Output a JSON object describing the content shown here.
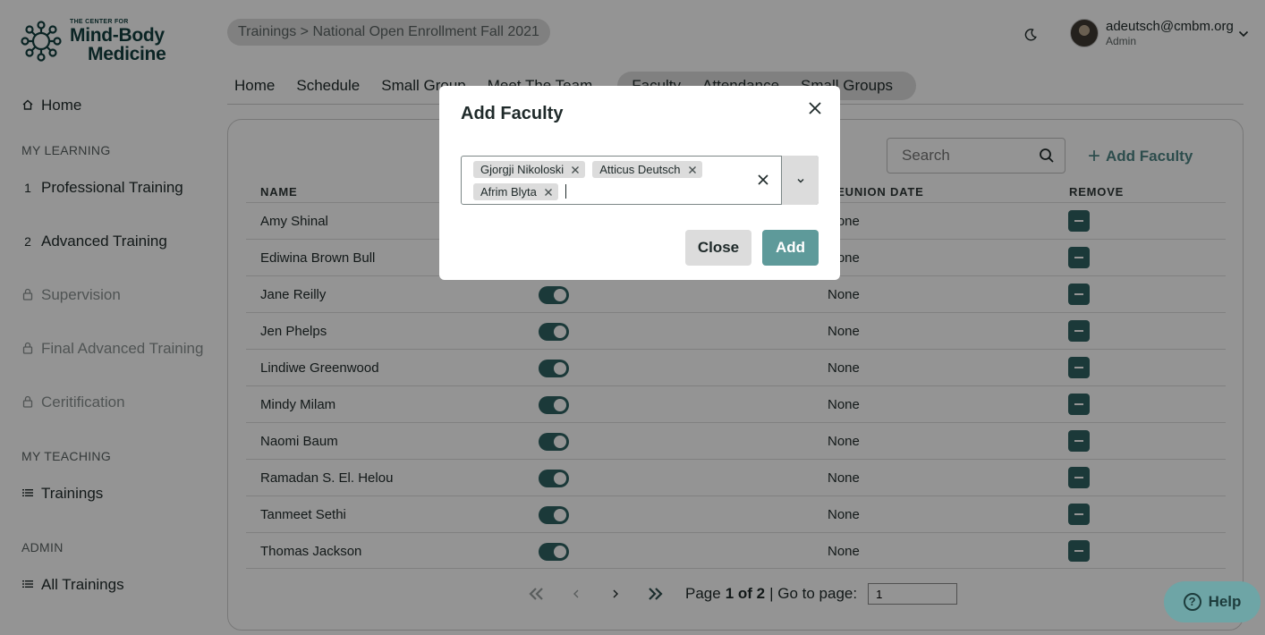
{
  "brand": {
    "small": "THE CENTER FOR",
    "line1": "Mind-Body",
    "line2": "Medicine"
  },
  "sidebar": {
    "home": "Home",
    "sections": {
      "learning": "MY LEARNING",
      "teaching": "MY TEACHING",
      "admin": "ADMIN"
    },
    "learning": [
      {
        "num": "1",
        "label": "Professional Training"
      },
      {
        "num": "2",
        "label": "Advanced Training"
      },
      {
        "label": "Supervision",
        "locked": true
      },
      {
        "label": "Final Advanced Training",
        "locked": true
      },
      {
        "label": "Ceritification",
        "locked": true
      }
    ],
    "teaching": [
      {
        "label": "Trainings"
      }
    ],
    "admin": [
      {
        "label": "All Trainings"
      }
    ]
  },
  "header": {
    "breadcrumb": "Trainings > National Open Enrollment Fall 2021",
    "user_email": "adeutsch@cmbm.org",
    "user_role": "Admin"
  },
  "tabs": {
    "plain": [
      "Home",
      "Schedule",
      "Small Group",
      "Meet The Team"
    ],
    "grouped": [
      "Faculty",
      "Attendance",
      "Small Groups"
    ]
  },
  "table": {
    "search_placeholder": "Search",
    "add_faculty_label": "Add Faculty",
    "headers": {
      "name": "NAME",
      "reunion": "REUNION DATE",
      "remove": "REMOVE"
    },
    "rows": [
      {
        "name": "Amy Shinal",
        "reunion": "None"
      },
      {
        "name": "Ediwina Brown Bull",
        "reunion": "None"
      },
      {
        "name": "Jane Reilly",
        "reunion": "None"
      },
      {
        "name": "Jen Phelps",
        "reunion": "None"
      },
      {
        "name": "Lindiwe Greenwood",
        "reunion": "None"
      },
      {
        "name": "Mindy Milam",
        "reunion": "None"
      },
      {
        "name": "Naomi Baum",
        "reunion": "None"
      },
      {
        "name": "Ramadan S. El. Helou",
        "reunion": "None"
      },
      {
        "name": "Tanmeet Sethi",
        "reunion": "None"
      },
      {
        "name": "Thomas Jackson",
        "reunion": "None"
      }
    ]
  },
  "pagination": {
    "page_word": "Page",
    "page_of": "1 of 2",
    "goto_label": "| Go to page:",
    "goto_value": "1"
  },
  "help": {
    "label": "Help"
  },
  "modal": {
    "title": "Add Faculty",
    "selected": [
      "Gjorgji Nikoloski",
      "Atticus Deutsch",
      "Afrim Blyta"
    ],
    "close_label": "Close",
    "add_label": "Add"
  },
  "colors": {
    "brand": "#123f3f",
    "accent": "#2f6262",
    "button": "#5e9a9a",
    "help": "#6ea5a6"
  }
}
